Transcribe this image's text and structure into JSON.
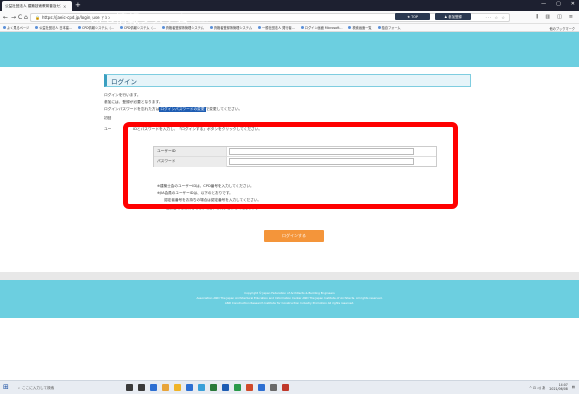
{
  "browser": {
    "tab_title": "公益社団法人 建築技術教育普及センター",
    "tab_close": "×",
    "new_tab": "+",
    "window_controls": [
      "—",
      "▢",
      "✕"
    ],
    "nav": {
      "back": "←",
      "forward": "→",
      "reload": "C",
      "home": "⌂"
    },
    "url_lock": "🔒",
    "url": "https://jaeic-cpd.jp/login_user.php",
    "url_right": "··· ☆ ☆",
    "tool_icons": [
      "⫼",
      "▥",
      "◫",
      "≡"
    ],
    "bookmarks": [
      "よく見るページ",
      "公益社団法人 日本建...",
      "CPD情報システム（...",
      "CPD情報システム（...",
      "資格者登録簿管理システム",
      "資格者登録簿管理システム",
      "一般社団法人 発行者...",
      "ログイン画面 Microsoft...",
      "検索画面一覧",
      "独自フォーム"
    ],
    "bookmarks_other": "他のブックマーク"
  },
  "site": {
    "title": "CPD情報システム",
    "subtitle": "参加者用",
    "btn_top": "TOP",
    "btn_register": "参加登録"
  },
  "login": {
    "heading": "ログイン",
    "info1": "ログインを行います。",
    "info2": "参加には、登録が必要となります。",
    "info3_pre": "ログインパスワードを忘れた方は",
    "info3_link": "ログインパスワードの変更",
    "info3_post": "で変更してください。",
    "info4": "初回",
    "info5": "ユー",
    "instruction": "IDとパスワードを入力し、「ログインする」ボタンをクリックしてください。",
    "user_id_label": "ユーザーID",
    "password_label": "パスワード",
    "note1": "※建築士会のユーザーIDは、CPD番号を入力してください。",
    "note2": "※JIA会員のユーザーIDは、以下のとおりです。",
    "note3": "　　認定者番号をお持ちの場合は認定番号を入力してください。",
    "note4": "　　「登録番号をお持ちでない場合、お問い合わせください。」",
    "submit": "ログインする"
  },
  "footer": {
    "line1": "Copyright © Japan Federation of Architects & Building Engineers",
    "line2": "Association AND The Japan Architectural Education and Information Center AND The Japan Institute of Architects. All rights reserved.",
    "line3": "AND Construction Research Institute for Construction Industry Promotion All rights reserved."
  },
  "taskbar": {
    "start": "⊞",
    "search_icon": "⌕",
    "search_placeholder": "ここに入力して検索",
    "app_colors": [
      "#3a3a3a",
      "#3a3a3a",
      "#2d6fd2",
      "#e8a43a",
      "#f0b428",
      "#2d6fd2",
      "#3aa0d8",
      "#2a7a3a",
      "#1e5db3",
      "#2a9a4a",
      "#d04a2a",
      "#2d6fd2",
      "#6a6a6a",
      "#c0392b"
    ],
    "tray": "^ ⊡ ◁) あ",
    "time": "14:07",
    "date": "2021/06/08",
    "notify": "▤"
  }
}
